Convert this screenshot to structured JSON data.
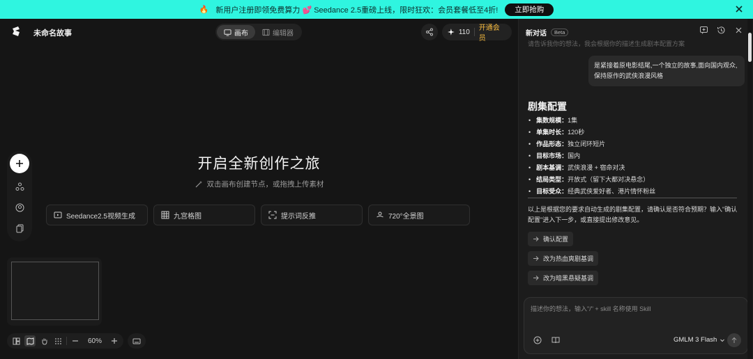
{
  "banner": {
    "emoji": "🔥",
    "text": "新用户注册即领免费算力 💕 Seedance 2.5重磅上线，限时狂欢：会员套餐低至4折!",
    "cta": "立即抢购"
  },
  "header": {
    "project_title": "未命名故事",
    "tabs": [
      {
        "label": "画布",
        "active": true
      },
      {
        "label": "编辑器",
        "active": false
      }
    ],
    "credits": "110",
    "vip_label": "开通会员"
  },
  "canvas": {
    "hero_title": "开启全新创作之旅",
    "hero_sub": "双击画布创建节点，或拖拽上传素材",
    "quick_actions": [
      {
        "label": "Seedance2.5视频生成",
        "icon": "video-icon"
      },
      {
        "label": "九宫格图",
        "icon": "grid-icon"
      },
      {
        "label": "提示词反推",
        "icon": "scan-icon"
      },
      {
        "label": "720°全景图",
        "icon": "panorama-icon"
      }
    ],
    "zoom": "60%"
  },
  "panel": {
    "title": "新对话",
    "badge": "Beta",
    "faded_text": "请告诉我你的想法，我会根据你的描述生成剧本配置方案",
    "user_message": "是紧接着原电影结尾,一个独立的故事,面向国内观众,保持原作的武侠浪漫风格",
    "section_title": "剧集配置",
    "config": [
      {
        "key": "集数规模：",
        "value": "1集"
      },
      {
        "key": "单集时长：",
        "value": "120秒"
      },
      {
        "key": "作品形态：",
        "value": "独立闭环短片"
      },
      {
        "key": "目标市场：",
        "value": "国内"
      },
      {
        "key": "剧本基调：",
        "value": "武侠浪漫 + 宿命对决"
      },
      {
        "key": "结局类型：",
        "value": "开放式（留下大都对决悬念）"
      },
      {
        "key": "目标受众：",
        "value": "经典武侠爱好者、港片情怀粉丝"
      }
    ],
    "summary": "以上是根据您的要求自动生成的剧集配置，请确认是否符合预期？输入\"确认配置\"进入下一步，或直接提出修改意见。",
    "suggestions": [
      "确认配置",
      "改为热血爽剧基调",
      "改为暗黑悬疑基调"
    ],
    "input_placeholder": "描述你的想法，输入\"/\" + skill 名称使用 Skill",
    "model": "GMLM 3 Flash"
  }
}
